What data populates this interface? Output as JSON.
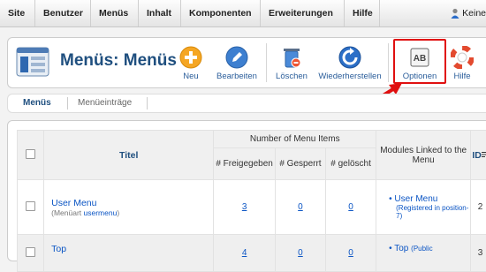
{
  "menubar": {
    "items": [
      "Site",
      "Benutzer",
      "Menüs",
      "Inhalt",
      "Komponenten",
      "Erweiterungen",
      "Hilfe"
    ],
    "user_label": "Keine"
  },
  "toolbar": {
    "title": "Menüs: Menüs",
    "buttons": {
      "neu": "Neu",
      "bearbeiten": "Bearbeiten",
      "loeschen": "Löschen",
      "wiederherstellen": "Wiederherstellen",
      "optionen": "Optionen",
      "hilfe": "Hilfe"
    },
    "optionen_glyph": "AB"
  },
  "tabs": {
    "active": "Menüs",
    "inactive": "Menüeinträge"
  },
  "table": {
    "headers": {
      "title": "Titel",
      "number_group": "Number of Menu Items",
      "published": "# Freigegeben",
      "unpublished": "# Gesperrt",
      "trashed": "# gelöscht",
      "modules_linked": "Modules Linked to the Menu",
      "id": "ID"
    },
    "rows": [
      {
        "title": "User Menu",
        "type_prefix": "(Menüart",
        "type_value": "usermenu",
        "type_suffix": ")",
        "published": "3",
        "unpublished": "0",
        "trashed": "0",
        "module": "User Menu",
        "module_sub": "(Registered in position-7)",
        "id": "2"
      },
      {
        "title": "Top",
        "published": "4",
        "unpublished": "0",
        "trashed": "0",
        "module": "Top",
        "module_sub": "(Public",
        "id": "3"
      }
    ]
  },
  "colors": {
    "title_blue": "#1f4f7f",
    "link_blue": "#0b55c4",
    "highlight_red": "#e01010"
  }
}
